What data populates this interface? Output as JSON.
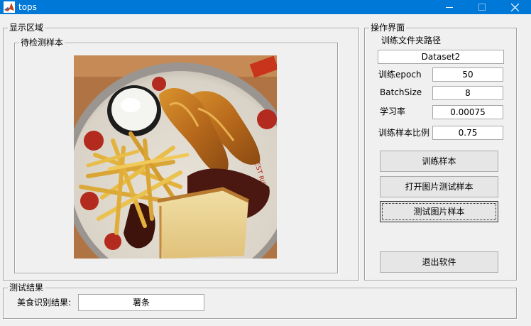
{
  "window": {
    "title": "tops"
  },
  "display_area": {
    "legend": "显示区域",
    "sample_panel": {
      "legend": "待检测样本",
      "image_icon": "food-photo-fries-fish"
    }
  },
  "operation_panel": {
    "legend": "操作界面",
    "path_label": "训练文件夹路径",
    "path_value": "Dataset2",
    "epoch_label": "训练epoch",
    "epoch_value": "50",
    "batch_label": "BatchSize",
    "batch_value": "8",
    "lr_label": "学习率",
    "lr_value": "0.00075",
    "ratio_label": "训练样本比例",
    "ratio_value": "0.75",
    "train_button": "训练样本",
    "open_image_button": "打开图片测试样本",
    "test_image_button": "测试图片样本",
    "exit_button": "退出软件"
  },
  "result_panel": {
    "legend": "测试结果",
    "result_label": "美食识别结果:",
    "result_value": "薯条"
  },
  "colors": {
    "titlebar": "#0078d7",
    "window_bg": "#f0f0f0"
  }
}
